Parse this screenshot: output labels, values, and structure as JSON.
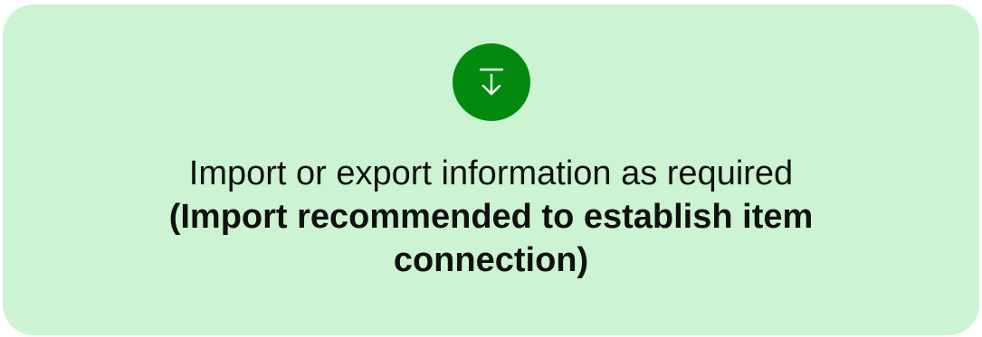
{
  "colors": {
    "card_background": "#CCF4D2",
    "icon_background": "#028A0F",
    "icon_foreground": "#FFFFFF",
    "text": "#111111"
  },
  "banner": {
    "icon": "download-icon",
    "line_regular": "Import or export information as required",
    "line_bold": "(Import recommended to establish item connection)"
  }
}
